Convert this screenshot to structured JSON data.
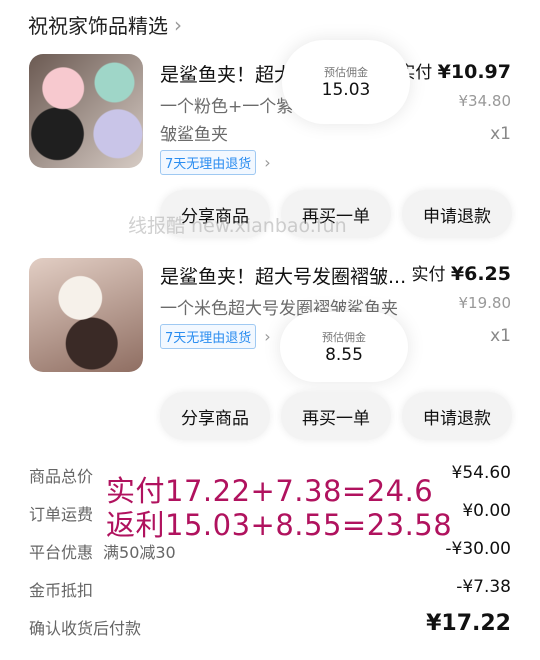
{
  "shop": {
    "name": "祝祝家饰品精选",
    "chevron_icon": "chevron-right-icon"
  },
  "items": [
    {
      "title": "是鲨鱼夹！超大",
      "variant_line1": "一个粉色+一个紫色",
      "variant_line2": "皱鲨鱼夹",
      "tag": "7天无理由退货",
      "paid_label": "实付",
      "paid_amount": "¥10.97",
      "original_price": "¥34.80",
      "quantity": "x1",
      "commission_label": "预估佣金",
      "commission_value": "15.03",
      "buttons": [
        "分享商品",
        "再买一单",
        "申请退款"
      ]
    },
    {
      "title": "是鲨鱼夹！超大号发圈褶皱...",
      "variant_line1": "一个米色超大号发圈褶皱鲨鱼夹",
      "tag": "7天无理由退货",
      "paid_label": "实付",
      "paid_amount": "¥6.25",
      "original_price": "¥19.80",
      "quantity": "x1",
      "commission_label": "预估佣金",
      "commission_value": "8.55",
      "buttons": [
        "分享商品",
        "再买一单",
        "申请退款"
      ]
    }
  ],
  "watermark": "线报酷 new.xianbao.fun",
  "summary": {
    "goods_total_label": "商品总价",
    "goods_total": "¥54.60",
    "shipping_label": "订单运费",
    "shipping": "¥0.00",
    "platform_discount_label": "平台优惠",
    "platform_discount_note": "满50减30",
    "platform_discount": "-¥30.00",
    "coin_deduct_label": "金币抵扣",
    "coin_deduct": "-¥7.38",
    "pay_after_label": "确认收货后付款",
    "pay_after": "¥17.22"
  },
  "overlay": {
    "line1": "实付17.22+7.38=24.6",
    "line2": "返利15.03+8.55=23.58"
  },
  "colors": {
    "overlay": "#b0125e",
    "tag": "#2a8df0"
  }
}
